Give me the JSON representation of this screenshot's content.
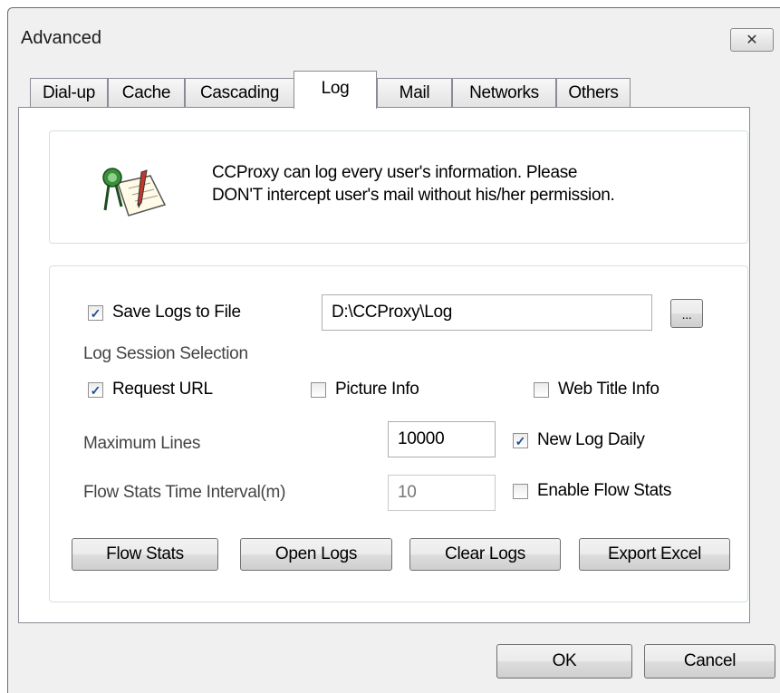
{
  "window": {
    "title": "Advanced",
    "close_glyph": "✕"
  },
  "tabs": [
    {
      "label": "Dial-up"
    },
    {
      "label": "Cache"
    },
    {
      "label": "Cascading"
    },
    {
      "label": "Log",
      "active": true
    },
    {
      "label": "Mail"
    },
    {
      "label": "Networks"
    },
    {
      "label": "Others"
    }
  ],
  "info": {
    "icon": "log-notepad-icon",
    "line1": "CCProxy can log every user's information. Please",
    "line2": "DON'T intercept user's mail without his/her permission."
  },
  "log": {
    "save_to_file": {
      "label": "Save Logs to File",
      "checked": true
    },
    "path": "D:\\CCProxy\\Log",
    "browse_label": "...",
    "session_heading": "Log Session Selection",
    "request_url": {
      "label": "Request URL",
      "checked": true
    },
    "picture_info": {
      "label": "Picture Info",
      "checked": false
    },
    "web_title_info": {
      "label": "Web Title Info",
      "checked": false
    },
    "max_lines_label": "Maximum Lines",
    "max_lines_value": "10000",
    "new_log_daily": {
      "label": "New Log Daily",
      "checked": true
    },
    "flow_interval_label": "Flow Stats Time Interval(m)",
    "flow_interval_value": "10",
    "enable_flow_stats": {
      "label": "Enable Flow Stats",
      "checked": false
    },
    "buttons": {
      "flow_stats": "Flow Stats",
      "open_logs": "Open Logs",
      "clear_logs": "Clear Logs",
      "export_excel": "Export Excel"
    }
  },
  "dialog_buttons": {
    "ok": "OK",
    "cancel": "Cancel"
  },
  "colors": {
    "window_bg": "#f0f0f0",
    "panel_bg": "#ffffff",
    "check_mark": "#1d4f91"
  }
}
